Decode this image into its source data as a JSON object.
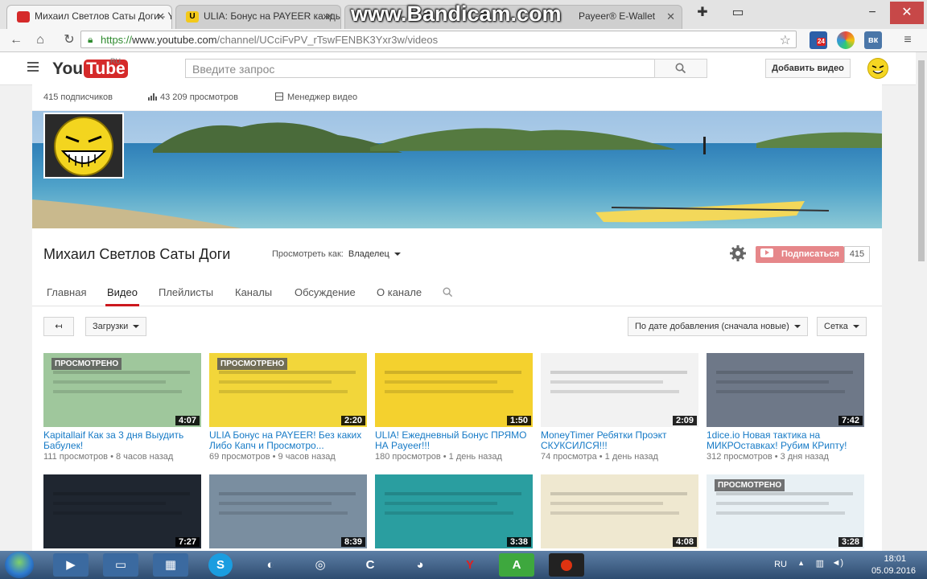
{
  "browser": {
    "tabs": [
      {
        "title": "Михаил Светлов Саты Доги - Y",
        "active": true
      },
      {
        "title": "ULIA: Бонус на PAYEER кажды",
        "active": false
      },
      {
        "title": "Payeer® E-Wallet",
        "active": false
      }
    ],
    "watermark": "www.Bandicam.com",
    "url_scheme": "https://",
    "url_host": "www.youtube.com",
    "url_path": "/channel/UCciFvPV_rTswFENBK3Yxr3w/videos",
    "extension_badge": "24"
  },
  "youtube": {
    "logo_you": "You",
    "logo_tube": "Tube",
    "logo_region": "RU",
    "search_placeholder": "Введите запрос",
    "add_video_label": "Добавить видео"
  },
  "channel": {
    "subscribers_label": "415 подписчиков",
    "views_label": "43 209 просмотров",
    "manager_label": "Менеджер видео",
    "name": "Михаил Светлов Саты Доги",
    "view_as_label": "Просмотреть как:",
    "view_as_value": "Владелец",
    "subscribe_label": "Подписаться",
    "subscribe_count": "415",
    "tabs": [
      {
        "label": "Главная",
        "active": false
      },
      {
        "label": "Видео",
        "active": true
      },
      {
        "label": "Плейлисты",
        "active": false
      },
      {
        "label": "Каналы",
        "active": false
      },
      {
        "label": "Обсуждение",
        "active": false
      },
      {
        "label": "О канале",
        "active": false
      }
    ]
  },
  "videos": {
    "uploads_label": "Загрузки",
    "sort_label": "По дате добавления (сначала новые)",
    "view_label": "Сетка",
    "watched_label": "ПРОСМОТРЕНО",
    "row1": [
      {
        "title": "Kapitallaif Как за 3 дня Выудить Бабулек!",
        "duration": "4:07",
        "views": "111 просмотров",
        "age": "8 часов назад",
        "watched": true,
        "color": "#9fc79c"
      },
      {
        "title": "ULIA Бонус на PAYEER! Без каких Либо Капч и Просмотро...",
        "duration": "2:20",
        "views": "69 просмотров",
        "age": "9 часов назад",
        "watched": true,
        "color": "#f2d63a"
      },
      {
        "title": "ULIA! Ежедневный Бонус ПРЯМО НА Payeer!!!",
        "duration": "1:50",
        "views": "180 просмотров",
        "age": "1 день назад",
        "watched": false,
        "color": "#f4d12e"
      },
      {
        "title": "MoneyTimer Ребятки Проэкт СКУКСИЛСЯ!!!",
        "duration": "2:09",
        "views": "74 просмотра",
        "age": "1 день назад",
        "watched": false,
        "color": "#f2f2f2"
      },
      {
        "title": "1dice.io Новая тактика на МИКРОставках! Рубим КРипту!",
        "duration": "7:42",
        "views": "312 просмотров",
        "age": "3 дня назад",
        "watched": false,
        "color": "#6e7888"
      }
    ],
    "row2": [
      {
        "duration": "7:27",
        "watched": false,
        "color": "#1f2630"
      },
      {
        "duration": "8:39",
        "watched": false,
        "color": "#7a8ea0"
      },
      {
        "duration": "3:38",
        "watched": false,
        "color": "#2a9ea0"
      },
      {
        "duration": "4:08",
        "watched": false,
        "color": "#efe8d0"
      },
      {
        "duration": "3:28",
        "watched": true,
        "color": "#e8f0f4"
      }
    ]
  },
  "taskbar": {
    "language": "RU",
    "time": "18:01",
    "date": "05.09.2016"
  }
}
